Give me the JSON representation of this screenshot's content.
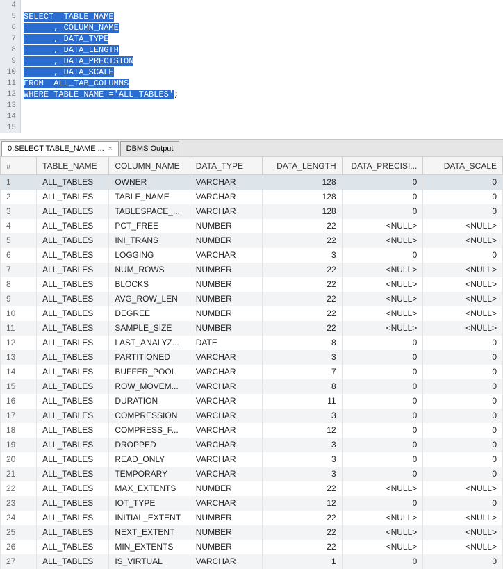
{
  "editor": {
    "lines": [
      {
        "n": 4,
        "segments": []
      },
      {
        "n": 5,
        "segments": [
          {
            "t": "SELECT  TABLE_NAME",
            "sel": true
          }
        ]
      },
      {
        "n": 6,
        "segments": [
          {
            "t": "      , COLUMN_NAME",
            "sel": true
          }
        ]
      },
      {
        "n": 7,
        "segments": [
          {
            "t": "      , DATA_TYPE",
            "sel": true
          }
        ]
      },
      {
        "n": 8,
        "segments": [
          {
            "t": "      , DATA_LENGTH",
            "sel": true
          }
        ]
      },
      {
        "n": 9,
        "segments": [
          {
            "t": "      , DATA_PRECISION",
            "sel": true
          }
        ]
      },
      {
        "n": 10,
        "segments": [
          {
            "t": "      , DATA_SCALE",
            "sel": true
          }
        ]
      },
      {
        "n": 11,
        "segments": [
          {
            "t": "FROM  ALL_TAB_COLUMNS",
            "sel": true
          }
        ]
      },
      {
        "n": 12,
        "segments": [
          {
            "t": "WHERE TABLE_NAME ='ALL_TABLES'",
            "sel": true
          },
          {
            "t": ";",
            "sel": false
          }
        ]
      },
      {
        "n": 13,
        "segments": []
      },
      {
        "n": 14,
        "segments": []
      },
      {
        "n": 15,
        "segments": []
      }
    ]
  },
  "tabs": {
    "active": {
      "label": "0:SELECT TABLE_NAME  ...",
      "close": "×"
    },
    "inactive": {
      "label": "DBMS Output"
    }
  },
  "results": {
    "headers": [
      "#",
      "TABLE_NAME",
      "COLUMN_NAME",
      "DATA_TYPE",
      "DATA_LENGTH",
      "DATA_PRECISI...",
      "DATA_SCALE"
    ],
    "rows": [
      {
        "n": 1,
        "table": "ALL_TABLES",
        "col": "OWNER",
        "type": "VARCHAR",
        "len": "128",
        "prec": "0",
        "scale": "0",
        "sel": true
      },
      {
        "n": 2,
        "table": "ALL_TABLES",
        "col": "TABLE_NAME",
        "type": "VARCHAR",
        "len": "128",
        "prec": "0",
        "scale": "0"
      },
      {
        "n": 3,
        "table": "ALL_TABLES",
        "col": "TABLESPACE_...",
        "type": "VARCHAR",
        "len": "128",
        "prec": "0",
        "scale": "0",
        "alt": true
      },
      {
        "n": 4,
        "table": "ALL_TABLES",
        "col": "PCT_FREE",
        "type": "NUMBER",
        "len": "22",
        "prec": "<NULL>",
        "scale": "<NULL>"
      },
      {
        "n": 5,
        "table": "ALL_TABLES",
        "col": "INI_TRANS",
        "type": "NUMBER",
        "len": "22",
        "prec": "<NULL>",
        "scale": "<NULL>",
        "alt": true
      },
      {
        "n": 6,
        "table": "ALL_TABLES",
        "col": "LOGGING",
        "type": "VARCHAR",
        "len": "3",
        "prec": "0",
        "scale": "0"
      },
      {
        "n": 7,
        "table": "ALL_TABLES",
        "col": "NUM_ROWS",
        "type": "NUMBER",
        "len": "22",
        "prec": "<NULL>",
        "scale": "<NULL>",
        "alt": true
      },
      {
        "n": 8,
        "table": "ALL_TABLES",
        "col": "BLOCKS",
        "type": "NUMBER",
        "len": "22",
        "prec": "<NULL>",
        "scale": "<NULL>"
      },
      {
        "n": 9,
        "table": "ALL_TABLES",
        "col": "AVG_ROW_LEN",
        "type": "NUMBER",
        "len": "22",
        "prec": "<NULL>",
        "scale": "<NULL>",
        "alt": true
      },
      {
        "n": 10,
        "table": "ALL_TABLES",
        "col": "DEGREE",
        "type": "NUMBER",
        "len": "22",
        "prec": "<NULL>",
        "scale": "<NULL>"
      },
      {
        "n": 11,
        "table": "ALL_TABLES",
        "col": "SAMPLE_SIZE",
        "type": "NUMBER",
        "len": "22",
        "prec": "<NULL>",
        "scale": "<NULL>",
        "alt": true
      },
      {
        "n": 12,
        "table": "ALL_TABLES",
        "col": "LAST_ANALYZ...",
        "type": "DATE",
        "len": "8",
        "prec": "0",
        "scale": "0"
      },
      {
        "n": 13,
        "table": "ALL_TABLES",
        "col": "PARTITIONED",
        "type": "VARCHAR",
        "len": "3",
        "prec": "0",
        "scale": "0",
        "alt": true
      },
      {
        "n": 14,
        "table": "ALL_TABLES",
        "col": "BUFFER_POOL",
        "type": "VARCHAR",
        "len": "7",
        "prec": "0",
        "scale": "0"
      },
      {
        "n": 15,
        "table": "ALL_TABLES",
        "col": "ROW_MOVEM...",
        "type": "VARCHAR",
        "len": "8",
        "prec": "0",
        "scale": "0",
        "alt": true
      },
      {
        "n": 16,
        "table": "ALL_TABLES",
        "col": "DURATION",
        "type": "VARCHAR",
        "len": "11",
        "prec": "0",
        "scale": "0"
      },
      {
        "n": 17,
        "table": "ALL_TABLES",
        "col": "COMPRESSION",
        "type": "VARCHAR",
        "len": "3",
        "prec": "0",
        "scale": "0",
        "alt": true
      },
      {
        "n": 18,
        "table": "ALL_TABLES",
        "col": "COMPRESS_F...",
        "type": "VARCHAR",
        "len": "12",
        "prec": "0",
        "scale": "0"
      },
      {
        "n": 19,
        "table": "ALL_TABLES",
        "col": "DROPPED",
        "type": "VARCHAR",
        "len": "3",
        "prec": "0",
        "scale": "0",
        "alt": true
      },
      {
        "n": 20,
        "table": "ALL_TABLES",
        "col": "READ_ONLY",
        "type": "VARCHAR",
        "len": "3",
        "prec": "0",
        "scale": "0"
      },
      {
        "n": 21,
        "table": "ALL_TABLES",
        "col": "TEMPORARY",
        "type": "VARCHAR",
        "len": "3",
        "prec": "0",
        "scale": "0",
        "alt": true
      },
      {
        "n": 22,
        "table": "ALL_TABLES",
        "col": "MAX_EXTENTS",
        "type": "NUMBER",
        "len": "22",
        "prec": "<NULL>",
        "scale": "<NULL>"
      },
      {
        "n": 23,
        "table": "ALL_TABLES",
        "col": "IOT_TYPE",
        "type": "VARCHAR",
        "len": "12",
        "prec": "0",
        "scale": "0",
        "alt": true
      },
      {
        "n": 24,
        "table": "ALL_TABLES",
        "col": "INITIAL_EXTENT",
        "type": "NUMBER",
        "len": "22",
        "prec": "<NULL>",
        "scale": "<NULL>"
      },
      {
        "n": 25,
        "table": "ALL_TABLES",
        "col": "NEXT_EXTENT",
        "type": "NUMBER",
        "len": "22",
        "prec": "<NULL>",
        "scale": "<NULL>",
        "alt": true
      },
      {
        "n": 26,
        "table": "ALL_TABLES",
        "col": "MIN_EXTENTS",
        "type": "NUMBER",
        "len": "22",
        "prec": "<NULL>",
        "scale": "<NULL>"
      },
      {
        "n": 27,
        "table": "ALL_TABLES",
        "col": "IS_VIRTUAL",
        "type": "VARCHAR",
        "len": "1",
        "prec": "0",
        "scale": "0",
        "alt": true
      }
    ]
  }
}
